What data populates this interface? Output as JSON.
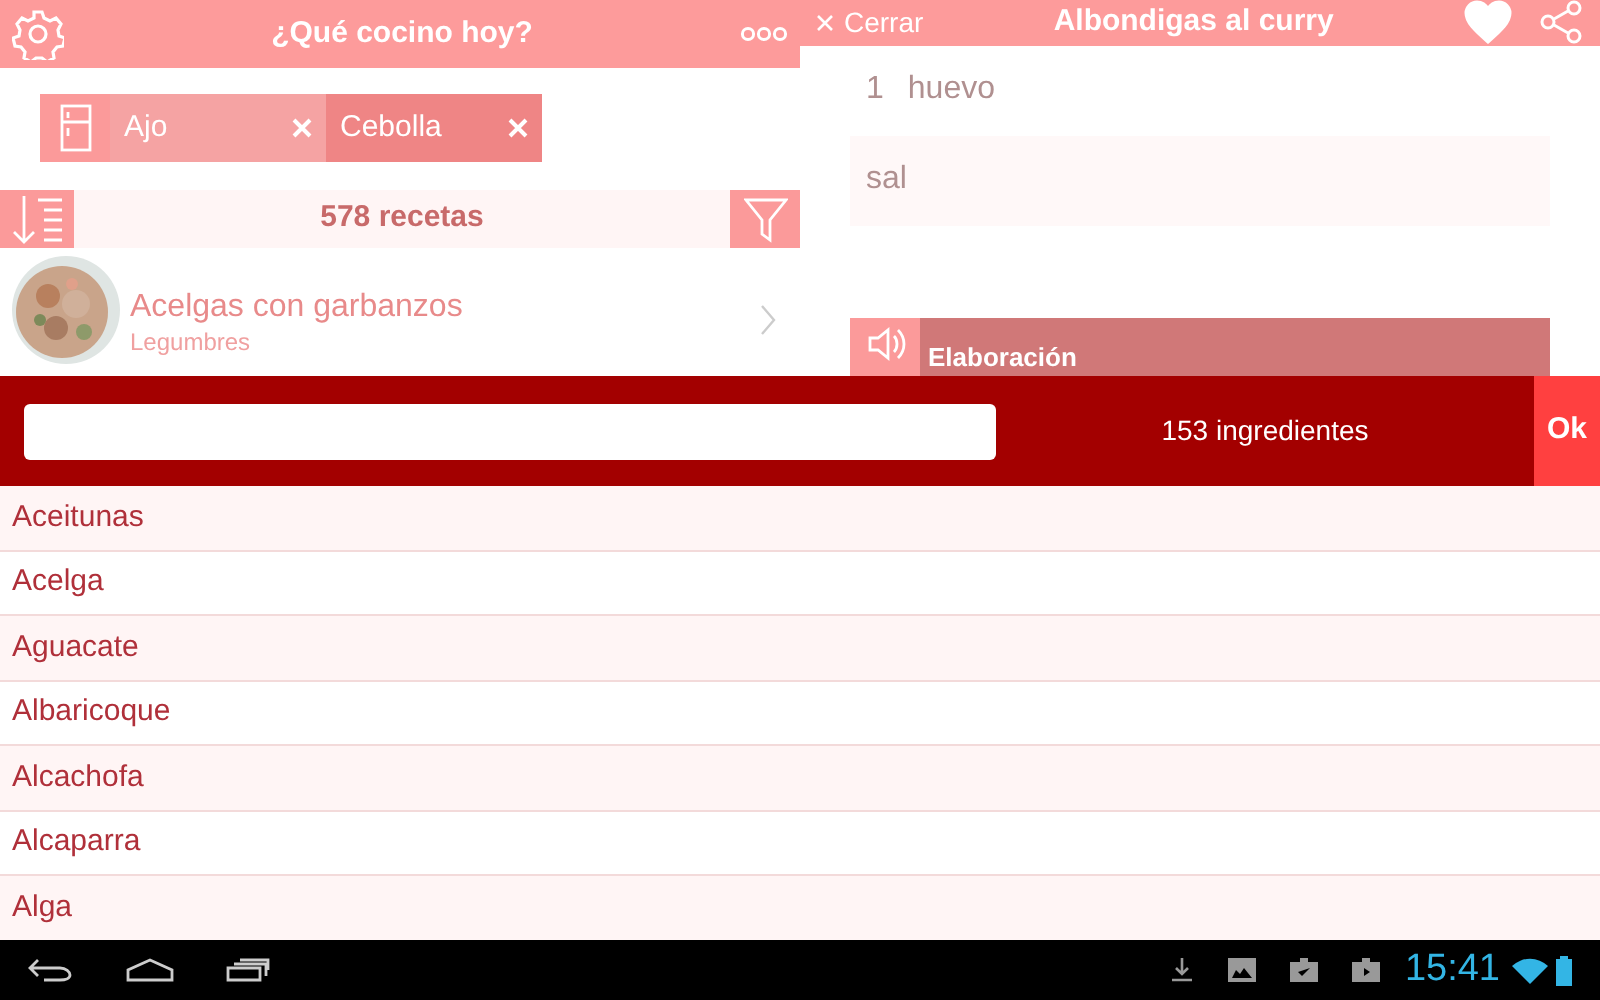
{
  "left_header": {
    "title": "¿Qué cocino hoy?"
  },
  "chips": [
    {
      "label": "Ajo",
      "selected": true
    },
    {
      "label": "Cebolla",
      "selected": false
    }
  ],
  "recipes_bar": {
    "count": "578 recetas"
  },
  "recipes": [
    {
      "title": "Acelgas con garbanzos",
      "category": "Legumbres"
    }
  ],
  "right_header": {
    "close": "Cerrar",
    "title": "Albondigas al curry",
    "favorite": true
  },
  "ingredients": [
    {
      "qty": "1",
      "name": "huevo"
    },
    {
      "name": "sal"
    }
  ],
  "section": {
    "title": "Elaboración"
  },
  "picker": {
    "count": "153 ingredientes",
    "ok": "Ok",
    "items": [
      "Aceitunas",
      "Acelga",
      "Aguacate",
      "Albaricoque",
      "Alcachofa",
      "Alcaparra",
      "Alga"
    ]
  },
  "status_bar": {
    "time": "15:41"
  }
}
